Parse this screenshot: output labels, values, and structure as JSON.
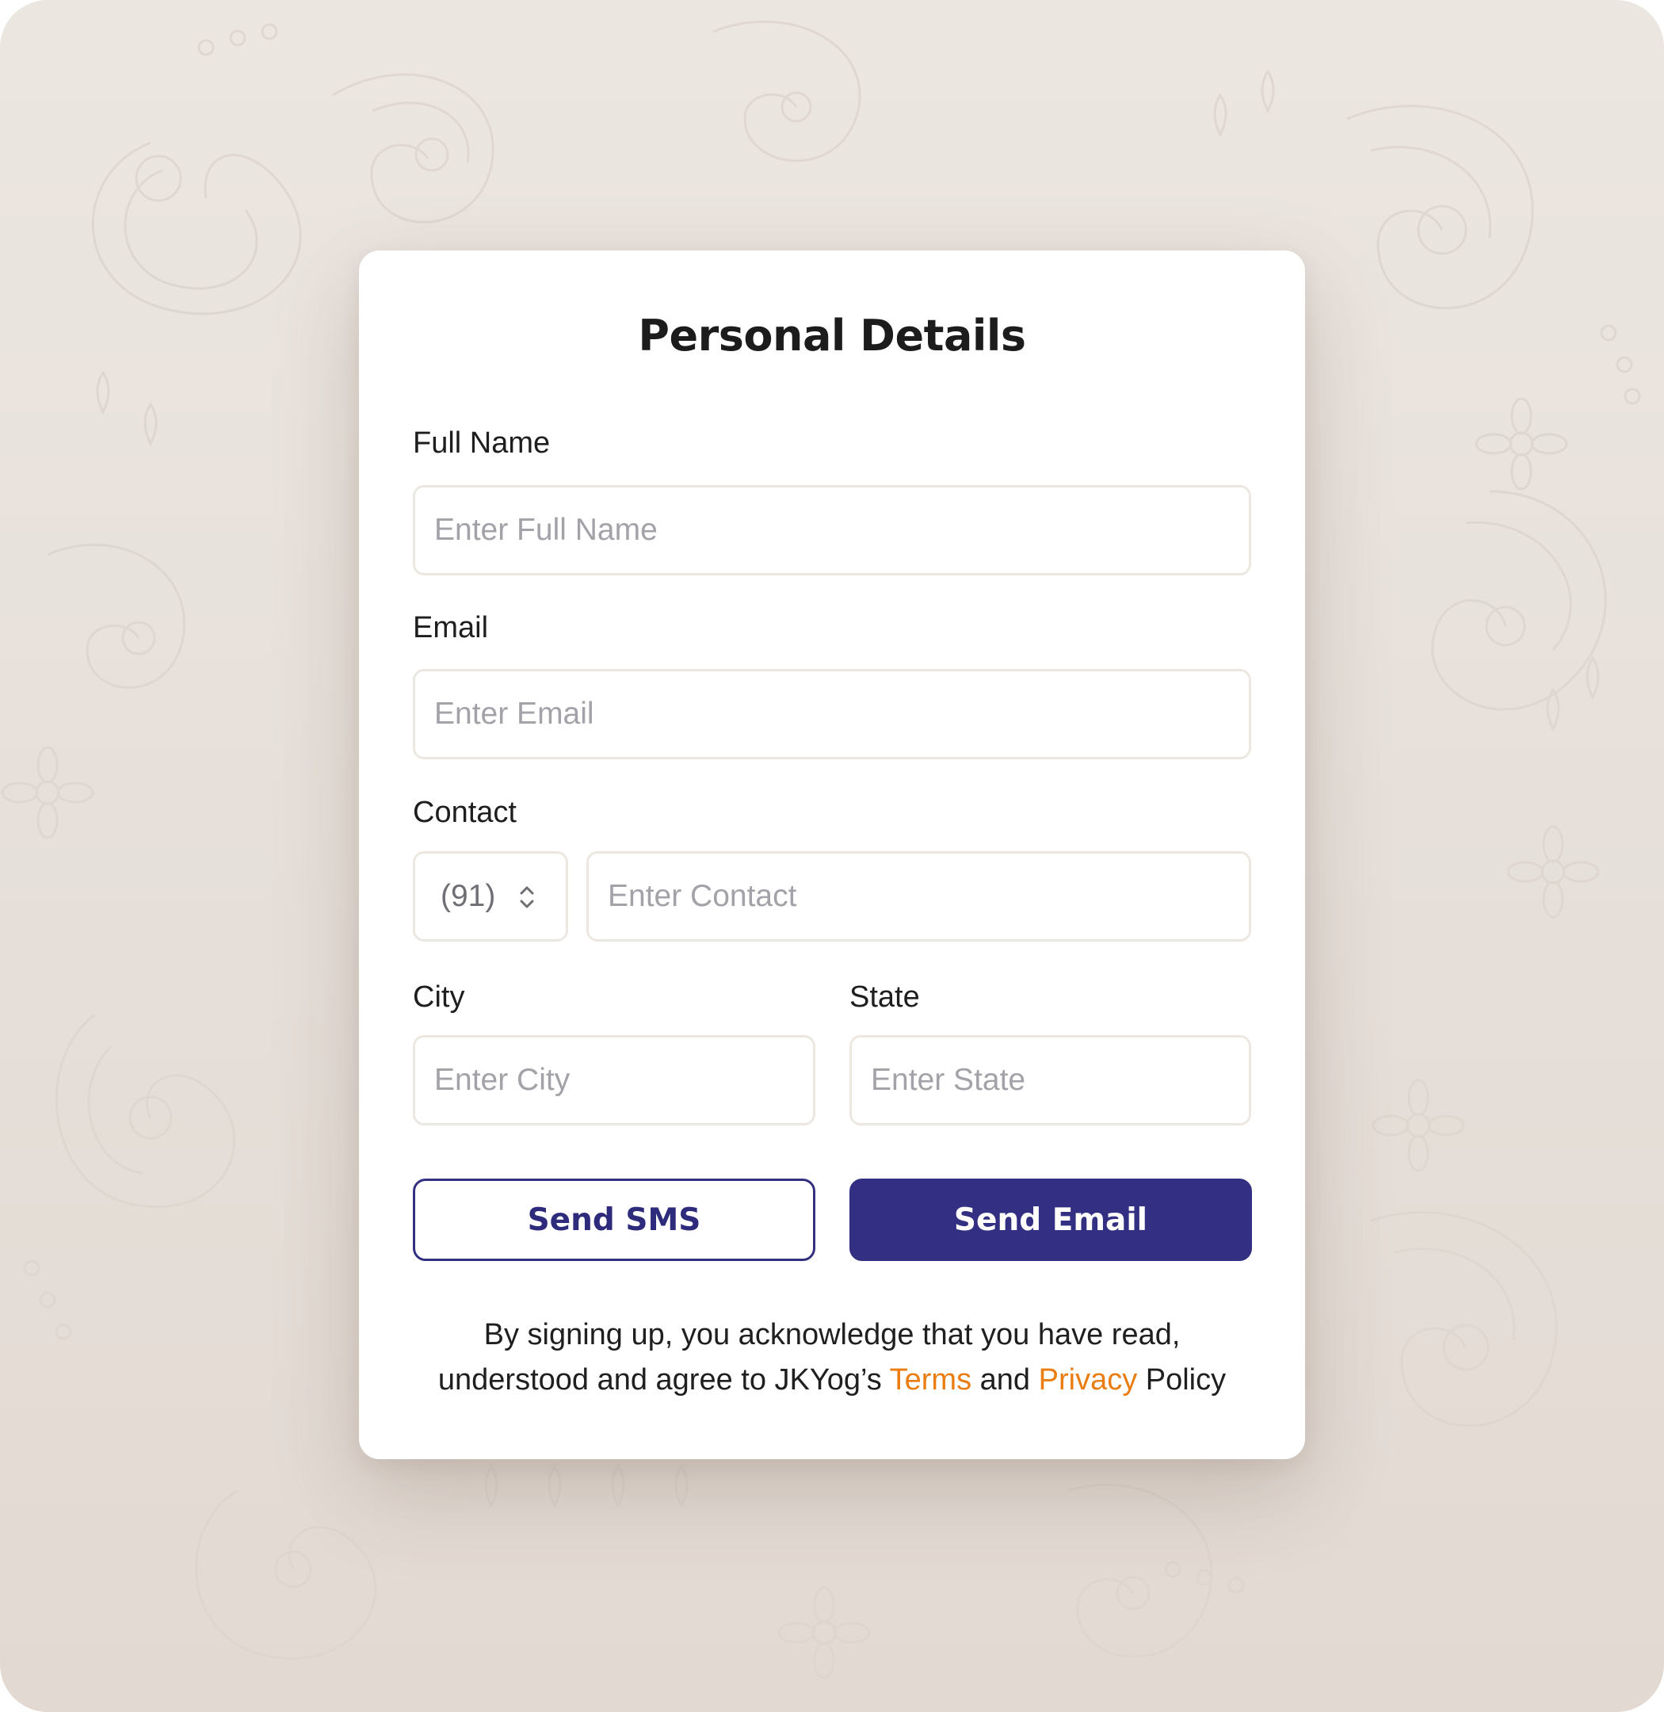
{
  "form": {
    "title": "Personal Details",
    "full_name": {
      "label": "Full Name",
      "placeholder": "Enter Full Name"
    },
    "email": {
      "label": "Email",
      "placeholder": "Enter Email"
    },
    "contact": {
      "label": "Contact",
      "country_code": "(91)",
      "placeholder": "Enter Contact"
    },
    "city": {
      "label": "City",
      "placeholder": "Enter City"
    },
    "state": {
      "label": "State",
      "placeholder": "Enter State"
    },
    "buttons": {
      "sms": "Send SMS",
      "email": "Send Email"
    },
    "disclaimer": {
      "line1": "By signing up, you acknowledge that you have read,",
      "line2_prefix": "understood and agree to JKYog’s ",
      "terms": "Terms",
      "and": " and ",
      "privacy": "Privacy",
      "policy": " Policy"
    }
  },
  "colors": {
    "primary": "#332f82",
    "link": "#ea7d11",
    "background": "#ebe5e0"
  }
}
